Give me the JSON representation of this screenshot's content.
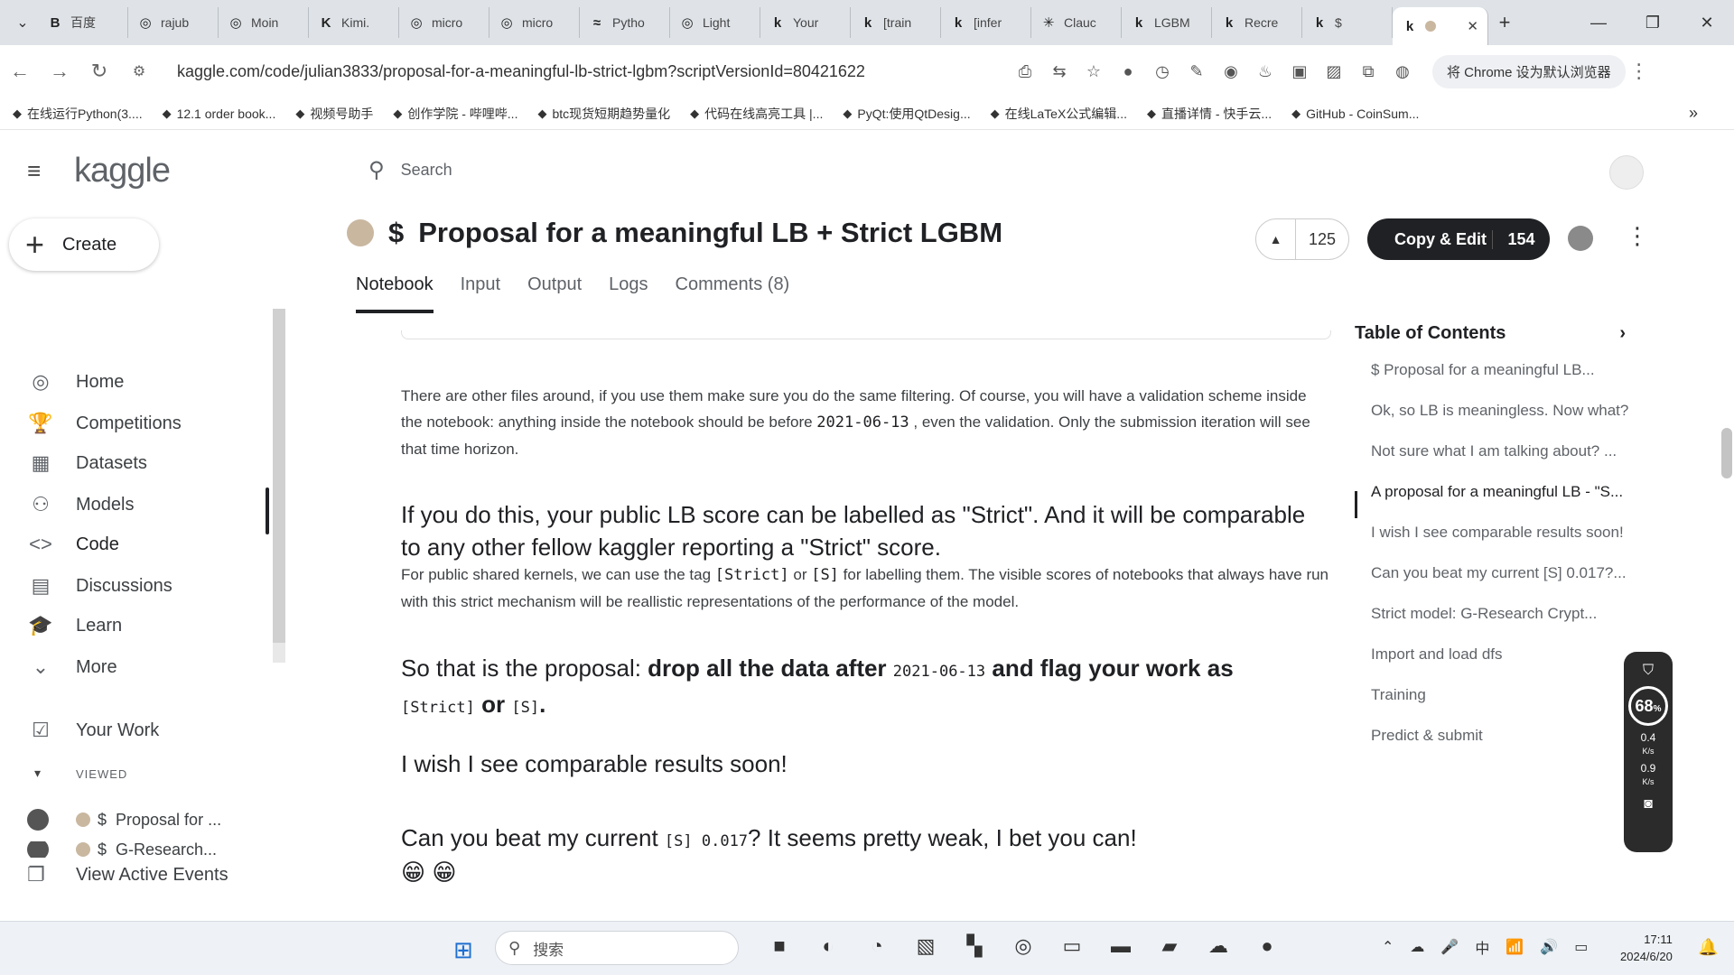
{
  "browser": {
    "tabs": [
      {
        "icon": "B",
        "label": "百度"
      },
      {
        "icon": "◎",
        "label": "rajub"
      },
      {
        "icon": "◎",
        "label": "Moin"
      },
      {
        "icon": "K",
        "label": "Kimi."
      },
      {
        "icon": "◎",
        "label": "micro"
      },
      {
        "icon": "◎",
        "label": "micro"
      },
      {
        "icon": "≈",
        "label": "Pytho"
      },
      {
        "icon": "◎",
        "label": "Light"
      },
      {
        "icon": "k",
        "label": "Your"
      },
      {
        "icon": "k",
        "label": "[train"
      },
      {
        "icon": "k",
        "label": "[infer"
      },
      {
        "icon": "✳",
        "label": "Clauc"
      },
      {
        "icon": "k",
        "label": "LGBM"
      },
      {
        "icon": "k",
        "label": "Recre"
      },
      {
        "icon": "k",
        "label": "$"
      }
    ],
    "active_tab": {
      "icon": "k",
      "label": ""
    },
    "url": "kaggle.com/code/julian3833/proposal-for-a-meaningful-lb-strict-lgbm?scriptVersionId=80421622",
    "default_browser_btn": "将 Chrome 设为默认浏览器",
    "bookmarks": [
      "在线运行Python(3....",
      "12.1 order book...",
      "视频号助手",
      "创作学院 - 哔哩哔...",
      "btc现货短期趋势量化",
      "代码在线高亮工具 |...",
      "PyQt:使用QtDesig...",
      "在线LaTeX公式编辑...",
      "直播详情 - 快手云...",
      "GitHub - CoinSum..."
    ]
  },
  "sidebar": {
    "logo": "kaggle",
    "create_label": "Create",
    "nav": [
      {
        "icon": "compass-icon",
        "glyph": "◎",
        "label": "Home"
      },
      {
        "icon": "trophy-icon",
        "glyph": "🏆",
        "label": "Competitions"
      },
      {
        "icon": "table-icon",
        "glyph": "▦",
        "label": "Datasets"
      },
      {
        "icon": "models-icon",
        "glyph": "⚇",
        "label": "Models"
      },
      {
        "icon": "code-icon",
        "glyph": "<>",
        "label": "Code"
      },
      {
        "icon": "discussions-icon",
        "glyph": "▤",
        "label": "Discussions"
      },
      {
        "icon": "learn-icon",
        "glyph": "🎓",
        "label": "Learn"
      },
      {
        "icon": "chevron-down-icon",
        "glyph": "⌄",
        "label": "More"
      }
    ],
    "your_work": "Your Work",
    "viewed_label": "VIEWED",
    "viewed": [
      {
        "symbol": "$",
        "label": "Proposal for ..."
      },
      {
        "symbol": "$",
        "label": "G-Research..."
      }
    ],
    "view_active_events": "View Active Events"
  },
  "search": {
    "placeholder": "Search"
  },
  "notebook": {
    "symbol": "$",
    "title": "Proposal for a meaningful LB + Strict LGBM",
    "votes": "125",
    "copy_edit_label": "Copy & Edit",
    "copy_edit_count": "154",
    "tabs": [
      "Notebook",
      "Input",
      "Output",
      "Logs",
      "Comments (8)"
    ]
  },
  "content": {
    "para1_a": "There are other files around, if you use them make sure you do the same filtering. Of course, you will have a validation scheme inside the notebook: anything inside the notebook should be before ",
    "para1_code": "2021-06-13",
    "para1_b": " , even the validation. Only the submission iteration will see that time horizon.",
    "h1": "If you do this, your public LB score can be labelled as \"Strict\". And it will be comparable to any other fellow kaggler reporting a \"Strict\" score.",
    "para2_a": "For public shared kernels, we can use the tag ",
    "para2_code1": "[Strict]",
    "para2_or": " or ",
    "para2_code2": "[S]",
    "para2_b": " for labelling them. The visible scores of notebooks that always have run with this strict mechanism will be reallistic representations of the performance of the model.",
    "h2_a": "So that is the proposal: ",
    "h2_bold_a": "drop all the data after ",
    "h2_code1": "2021-06-13",
    "h2_bold_b": " and flag your work as ",
    "h2_code2": "[Strict]",
    "h2_bold_or": " or ",
    "h2_code3": "[S]",
    "h2_end": ".",
    "h3": "I wish I see comparable results soon!",
    "h4_a": "Can you beat my current ",
    "h4_code": "[S] 0.017",
    "h4_b": "? It seems pretty weak, I bet you can!",
    "emoji": "😁 😁"
  },
  "toc": {
    "title": "Table of Contents",
    "items": [
      "$ Proposal for a meaningful LB...",
      "Ok, so LB is meaningless. Now what?",
      "Not sure what I am talking about? ...",
      "A proposal for a meaningful LB - \"S...",
      "I wish I see comparable results soon!",
      "Can you beat my current [S] 0.017?...",
      "Strict model: G-Research Crypt...",
      "Import and load dfs",
      "Training",
      "Predict & submit"
    ]
  },
  "widget": {
    "percent": "68",
    "unit": "%",
    "up_rate": "0.4",
    "down_rate": "0.9",
    "rate_unit": "K/s"
  },
  "taskbar": {
    "search_placeholder": "搜索",
    "ime": "中",
    "time": "17:11",
    "date": "2024/6/20"
  }
}
